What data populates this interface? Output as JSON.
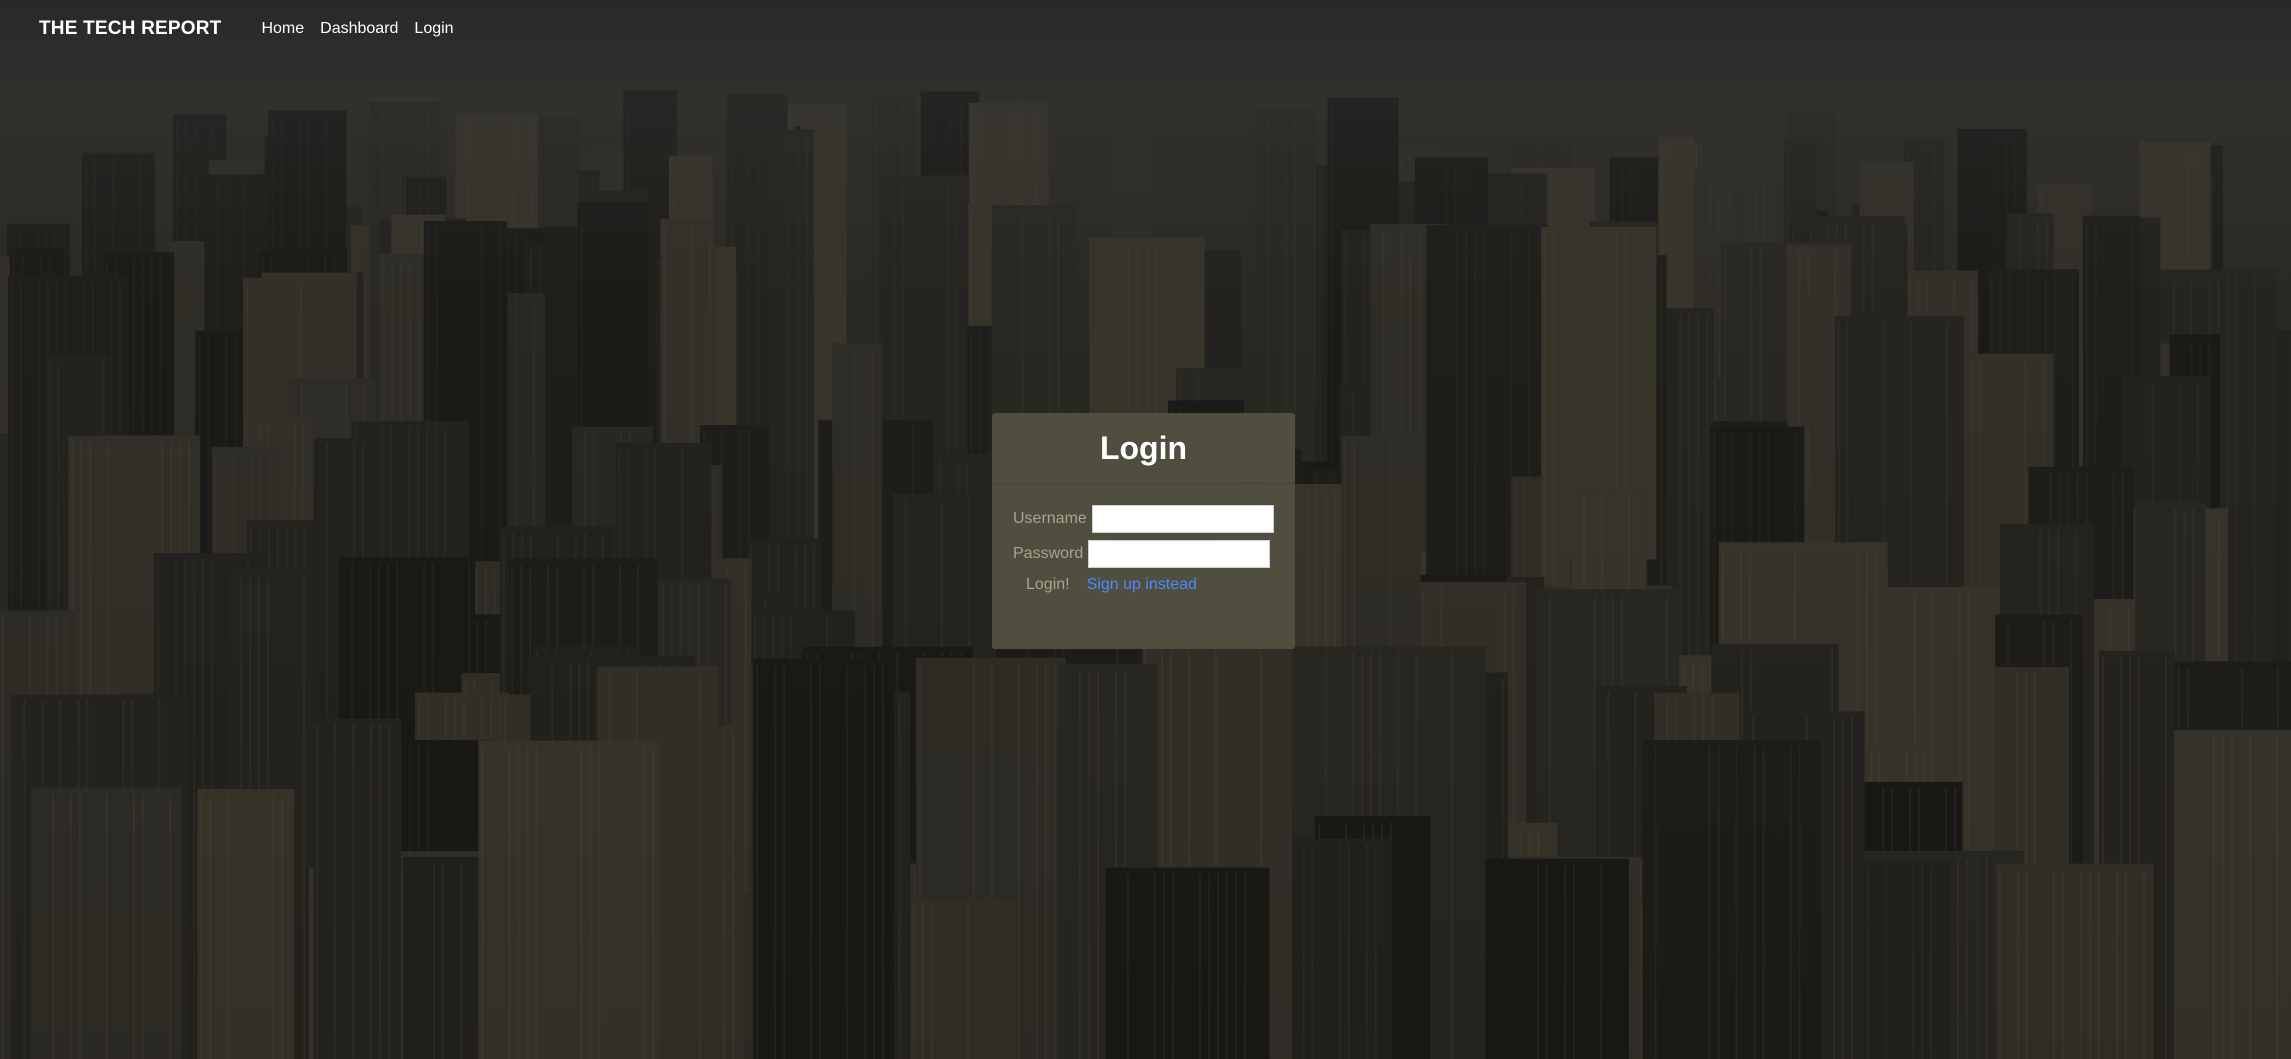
{
  "navbar": {
    "brand": "THE TECH REPORT",
    "links": [
      "Home",
      "Dashboard",
      "Login"
    ]
  },
  "login_card": {
    "title": "Login",
    "username_label": "Username",
    "password_label": "Password",
    "submit_label": "Login!",
    "signup_link": "Sign up instead"
  },
  "colors": {
    "card_background": "#524f40",
    "link": "#4a8bff",
    "label": "#a8a48f"
  }
}
